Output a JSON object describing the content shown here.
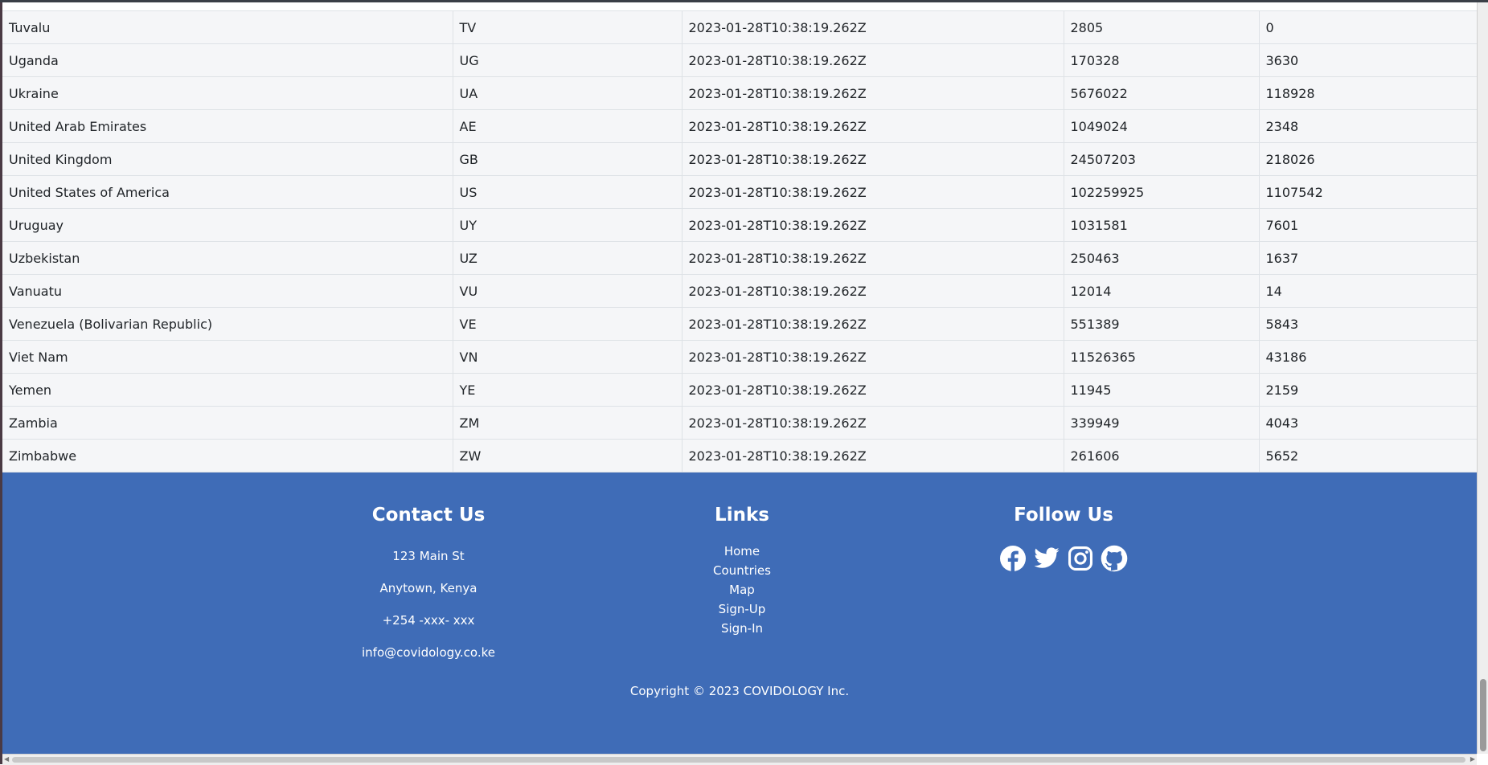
{
  "table": {
    "rows": [
      {
        "country": "Tuvalu",
        "code": "TV",
        "date": "2023-01-28T10:38:19.262Z",
        "confirmed": "2805",
        "deaths": "0"
      },
      {
        "country": "Uganda",
        "code": "UG",
        "date": "2023-01-28T10:38:19.262Z",
        "confirmed": "170328",
        "deaths": "3630"
      },
      {
        "country": "Ukraine",
        "code": "UA",
        "date": "2023-01-28T10:38:19.262Z",
        "confirmed": "5676022",
        "deaths": "118928"
      },
      {
        "country": "United Arab Emirates",
        "code": "AE",
        "date": "2023-01-28T10:38:19.262Z",
        "confirmed": "1049024",
        "deaths": "2348"
      },
      {
        "country": "United Kingdom",
        "code": "GB",
        "date": "2023-01-28T10:38:19.262Z",
        "confirmed": "24507203",
        "deaths": "218026"
      },
      {
        "country": "United States of America",
        "code": "US",
        "date": "2023-01-28T10:38:19.262Z",
        "confirmed": "102259925",
        "deaths": "1107542"
      },
      {
        "country": "Uruguay",
        "code": "UY",
        "date": "2023-01-28T10:38:19.262Z",
        "confirmed": "1031581",
        "deaths": "7601"
      },
      {
        "country": "Uzbekistan",
        "code": "UZ",
        "date": "2023-01-28T10:38:19.262Z",
        "confirmed": "250463",
        "deaths": "1637"
      },
      {
        "country": "Vanuatu",
        "code": "VU",
        "date": "2023-01-28T10:38:19.262Z",
        "confirmed": "12014",
        "deaths": "14"
      },
      {
        "country": "Venezuela (Bolivarian Republic)",
        "code": "VE",
        "date": "2023-01-28T10:38:19.262Z",
        "confirmed": "551389",
        "deaths": "5843"
      },
      {
        "country": "Viet Nam",
        "code": "VN",
        "date": "2023-01-28T10:38:19.262Z",
        "confirmed": "11526365",
        "deaths": "43186"
      },
      {
        "country": "Yemen",
        "code": "YE",
        "date": "2023-01-28T10:38:19.262Z",
        "confirmed": "11945",
        "deaths": "2159"
      },
      {
        "country": "Zambia",
        "code": "ZM",
        "date": "2023-01-28T10:38:19.262Z",
        "confirmed": "339949",
        "deaths": "4043"
      },
      {
        "country": "Zimbabwe",
        "code": "ZW",
        "date": "2023-01-28T10:38:19.262Z",
        "confirmed": "261606",
        "deaths": "5652"
      }
    ]
  },
  "footer": {
    "contact": {
      "title": "Contact Us",
      "address": "123 Main St",
      "city": "Anytown, Kenya",
      "phone": "+254 -xxx- xxx",
      "email": "info@covidology.co.ke"
    },
    "links": {
      "title": "Links",
      "items": [
        "Home",
        "Countries",
        "Map",
        "Sign-Up",
        "Sign-In"
      ]
    },
    "follow": {
      "title": "Follow Us",
      "icons": [
        "facebook-icon",
        "twitter-icon",
        "instagram-icon",
        "github-icon"
      ]
    },
    "copyright": "Copyright © 2023 COVIDOLOGY Inc."
  },
  "colors": {
    "footer_bg": "#3f6cb7",
    "row_bg": "#f5f6f8"
  }
}
